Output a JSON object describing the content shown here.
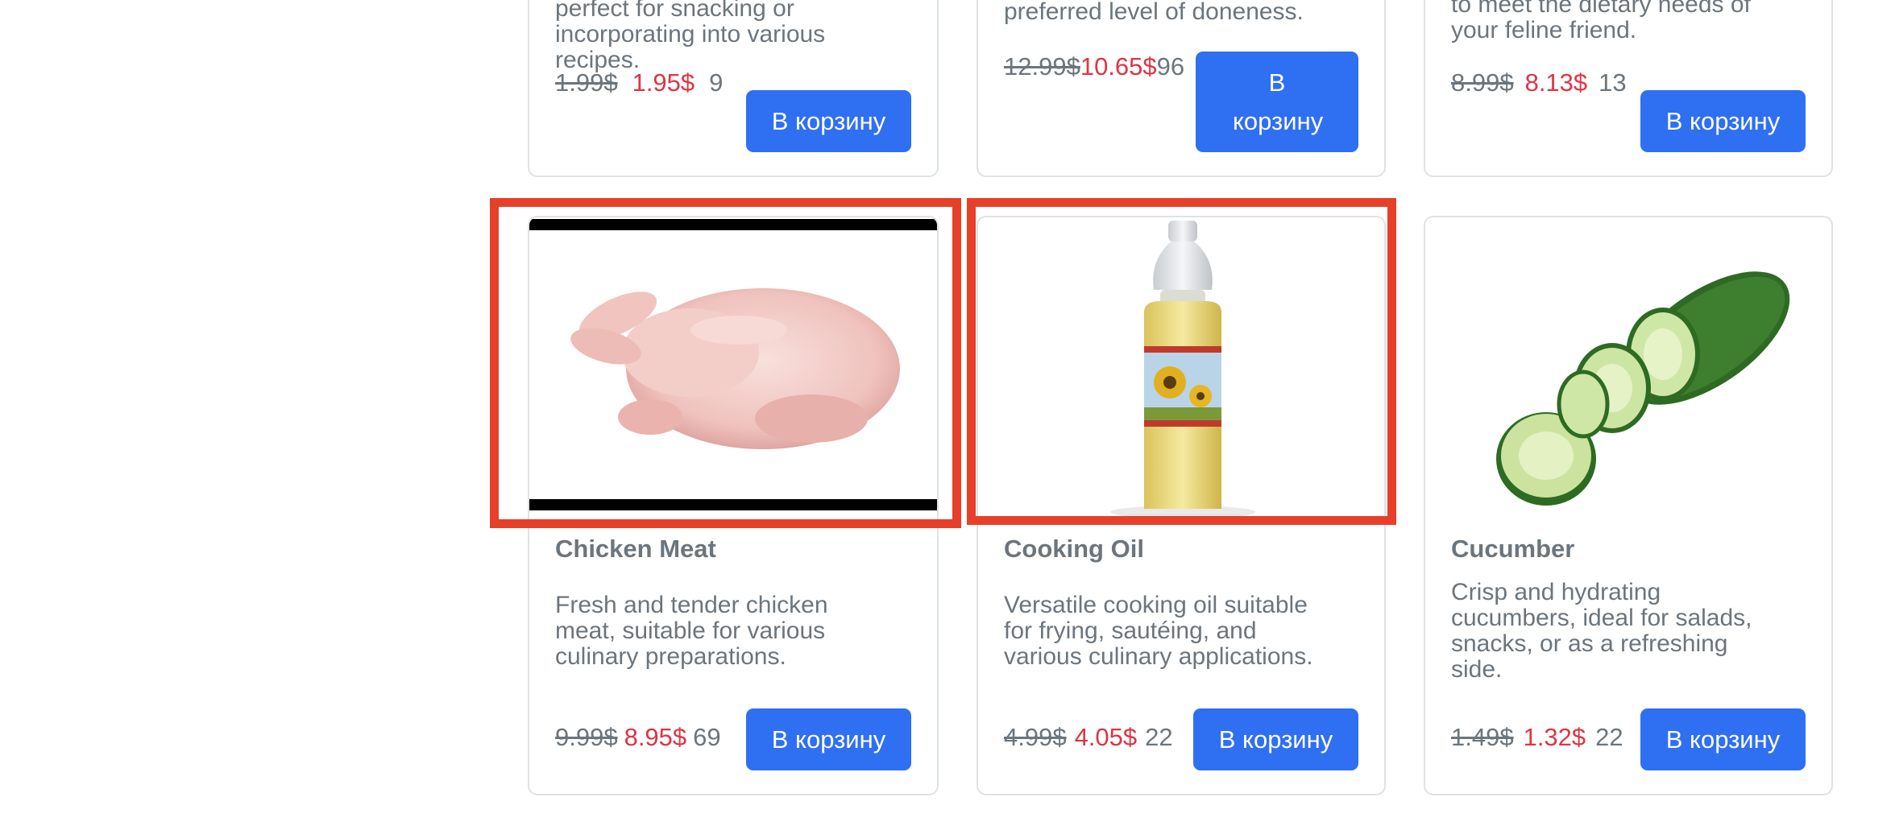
{
  "top_row": [
    {
      "desc": [
        "perfect for snacking or",
        "incorporating into various",
        "recipes."
      ],
      "old_price": "1.99$",
      "new_price": "1.95$",
      "stock": "9",
      "button": "В корзину"
    },
    {
      "desc": [
        "preferred level of doneness."
      ],
      "old_price": "12.99$",
      "new_price": "10.65$",
      "stock": "96",
      "button": "В корзину"
    },
    {
      "desc": [
        "to meet the dietary needs of",
        "your feline friend."
      ],
      "old_price": "8.99$",
      "new_price": "8.13$",
      "stock": "13",
      "button": "В корзину"
    }
  ],
  "products": [
    {
      "title": "Chicken Meat",
      "desc": [
        "Fresh and tender chicken",
        "meat, suitable for various",
        "culinary preparations."
      ],
      "old_price": "9.99$",
      "new_price": "8.95$",
      "stock": "69",
      "button": "В корзину",
      "image_icon": "chicken-image"
    },
    {
      "title": "Cooking Oil",
      "desc": [
        "Versatile cooking oil suitable",
        "for frying, sautéing, and",
        "various culinary applications."
      ],
      "old_price": "4.99$",
      "new_price": "4.05$",
      "stock": "22",
      "button": "В корзину",
      "image_icon": "oil-bottle-image"
    },
    {
      "title": "Cucumber",
      "desc": [
        "Crisp and hydrating",
        "cucumbers, ideal for salads,",
        "snacks, or as a refreshing",
        "side."
      ],
      "old_price": "1.49$",
      "new_price": "1.32$",
      "stock": "22",
      "button": "В корзину",
      "image_icon": "cucumber-image"
    }
  ],
  "colors": {
    "accent": "#2f6ff2",
    "sale": "#dc3545",
    "muted": "#6c757d",
    "highlight": "#e6402a"
  }
}
